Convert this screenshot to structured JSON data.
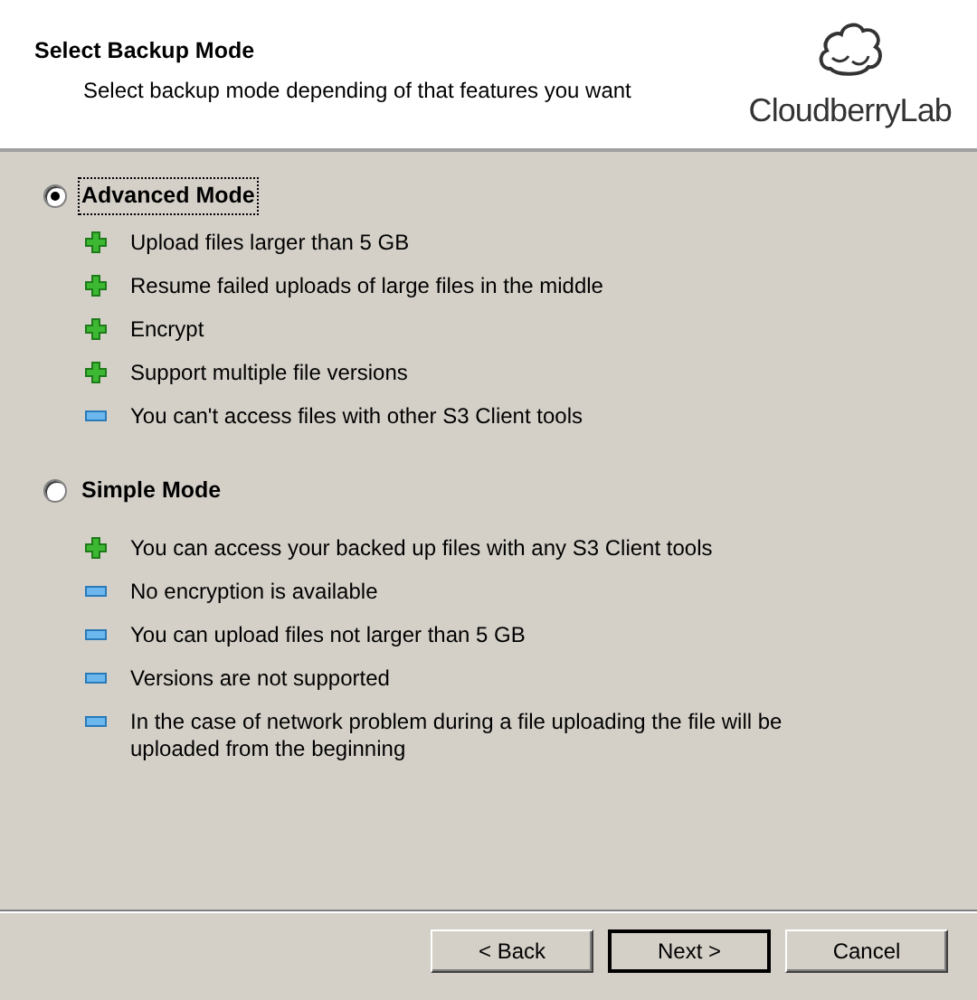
{
  "header": {
    "title": "Select Backup Mode",
    "subtitle": "Select backup mode depending of that features you want",
    "logo": "CloudberryLab"
  },
  "modes": [
    {
      "label": "Advanced Mode",
      "selected": true,
      "focused": true,
      "features": [
        {
          "kind": "plus",
          "text": "Upload files larger than 5 GB"
        },
        {
          "kind": "plus",
          "text": "Resume failed uploads of large files in the middle"
        },
        {
          "kind": "plus",
          "text": "Encrypt"
        },
        {
          "kind": "plus",
          "text": "Support multiple file versions"
        },
        {
          "kind": "minus",
          "text": "You can't access files with other S3 Client tools"
        }
      ]
    },
    {
      "label": "Simple Mode",
      "selected": false,
      "focused": false,
      "features": [
        {
          "kind": "plus",
          "text": "You can access your backed up files with any S3 Client tools"
        },
        {
          "kind": "minus",
          "text": "No encryption is available"
        },
        {
          "kind": "minus",
          "text": "You can upload files not larger than 5 GB"
        },
        {
          "kind": "minus",
          "text": "Versions are not supported"
        },
        {
          "kind": "minus",
          "text": "In the case of network problem during a file uploading the file will be uploaded from the beginning"
        }
      ]
    }
  ],
  "buttons": [
    {
      "label": "< Back",
      "default": false
    },
    {
      "label": "Next >",
      "default": true
    },
    {
      "label": "Cancel",
      "default": false
    }
  ]
}
